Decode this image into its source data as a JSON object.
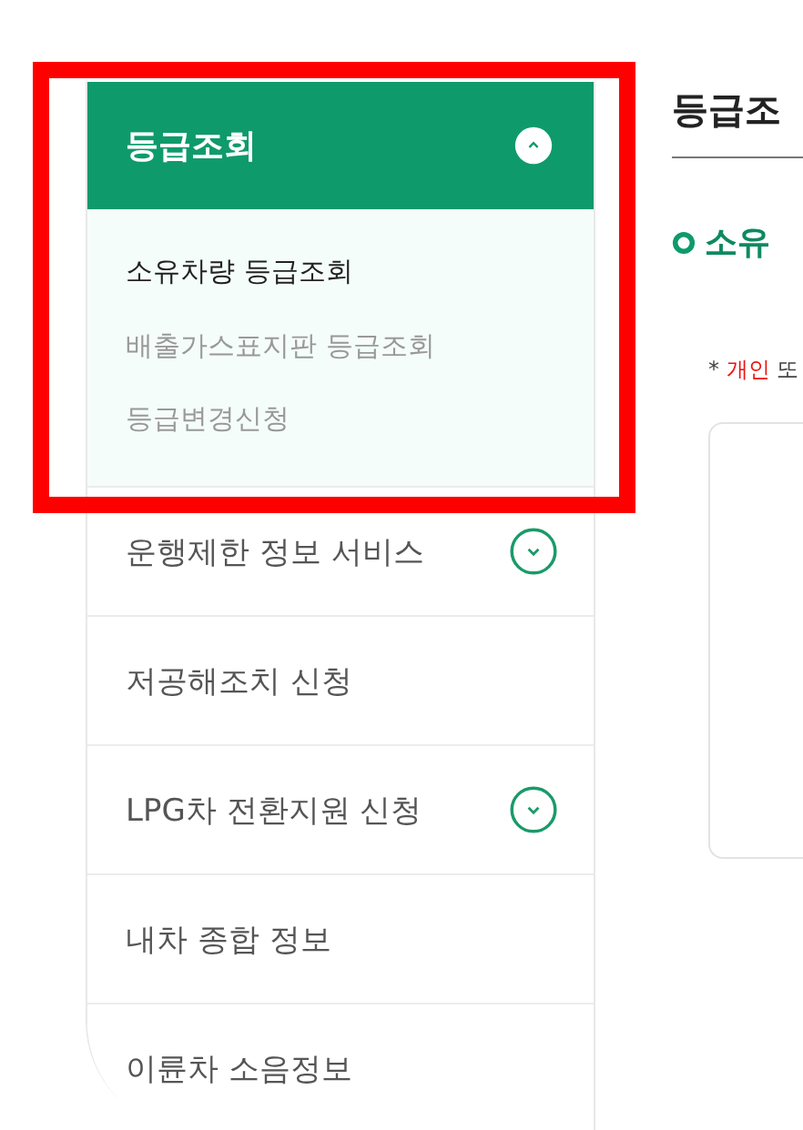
{
  "sidebar": {
    "items": [
      {
        "label": "등급조회",
        "expandable": true,
        "expanded": true,
        "children": [
          {
            "label": "소유차량 등급조회",
            "selected": true
          },
          {
            "label": "배출가스표지판 등급조회",
            "selected": false
          },
          {
            "label": "등급변경신청",
            "selected": false
          }
        ]
      },
      {
        "label": "운행제한 정보 서비스",
        "expandable": true,
        "expanded": false
      },
      {
        "label": "저공해조치 신청",
        "expandable": false,
        "expanded": false
      },
      {
        "label": "LPG차 전환지원 신청",
        "expandable": true,
        "expanded": false
      },
      {
        "label": "내차 종합 정보",
        "expandable": false,
        "expanded": false
      },
      {
        "label": "이륜차 소음정보",
        "expandable": false,
        "expanded": false
      }
    ]
  },
  "highlight": {
    "shown": true
  },
  "main": {
    "title": "등급조",
    "section_title": "소유",
    "note": {
      "mark": "*",
      "highlight": "개인",
      "rest": "또"
    }
  }
}
